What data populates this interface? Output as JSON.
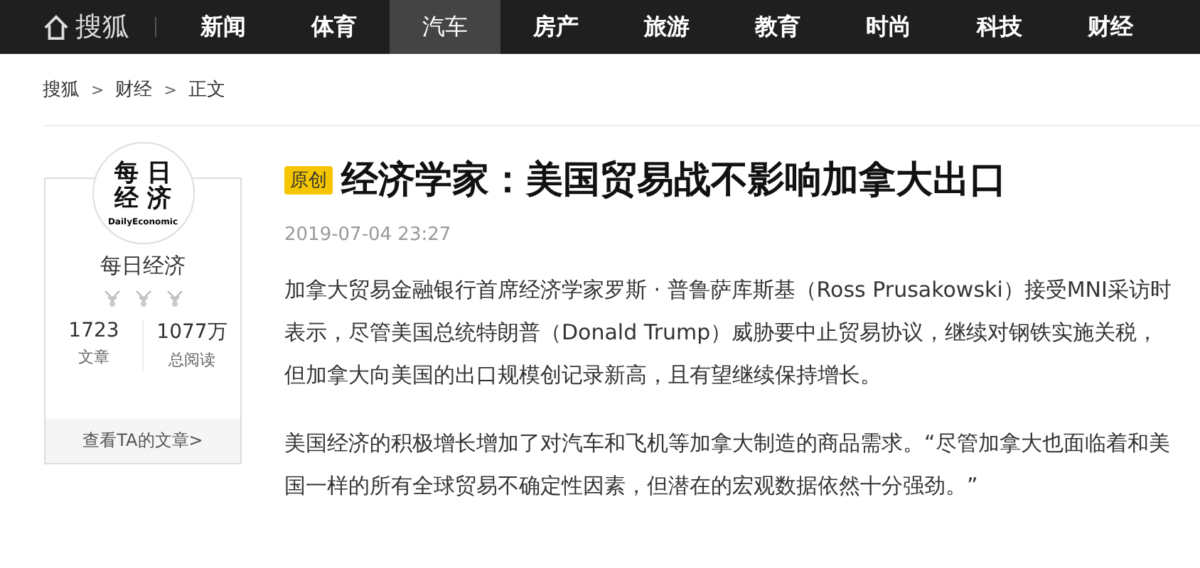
{
  "nav": {
    "logo": "搜狐",
    "items": [
      {
        "label": "新闻",
        "selected": false
      },
      {
        "label": "体育",
        "selected": false
      },
      {
        "label": "汽车",
        "selected": true
      },
      {
        "label": "房产",
        "selected": false
      },
      {
        "label": "旅游",
        "selected": false
      },
      {
        "label": "教育",
        "selected": false
      },
      {
        "label": "时尚",
        "selected": false
      },
      {
        "label": "科技",
        "selected": false
      },
      {
        "label": "财经",
        "selected": false
      }
    ]
  },
  "breadcrumb": {
    "separator": ">",
    "items": [
      "搜狐",
      "财经",
      "正文"
    ]
  },
  "author": {
    "avatar_lines": [
      "每 日",
      "经 济"
    ],
    "avatar_sub": "DailyEconomic",
    "name": "每日经济",
    "stats": [
      {
        "value": "1723",
        "label": "文章"
      },
      {
        "value": "1077万",
        "label": "总阅读"
      }
    ],
    "link": "查看TA的文章>"
  },
  "article": {
    "tag": "原创",
    "title": "经济学家：美国贸易战不影响加拿大出口",
    "date": "2019-07-04 23:27",
    "paragraphs": [
      "加拿大贸易金融银行首席经济学家罗斯 · 普鲁萨库斯基（Ross Prusakowski）接受MNI采访时表示，尽管美国总统特朗普（Donald Trump）威胁要中止贸易协议，继续对钢铁实施关税，但加拿大向美国的出口规模创记录新高，且有望继续保持增长。",
      "美国经济的积极增长增加了对汽车和飞机等加拿大制造的商品需求。“尽管加拿大也面临着和美国一样的所有全球贸易不确定性因素，但潜在的宏观数据依然十分强劲。”"
    ]
  }
}
